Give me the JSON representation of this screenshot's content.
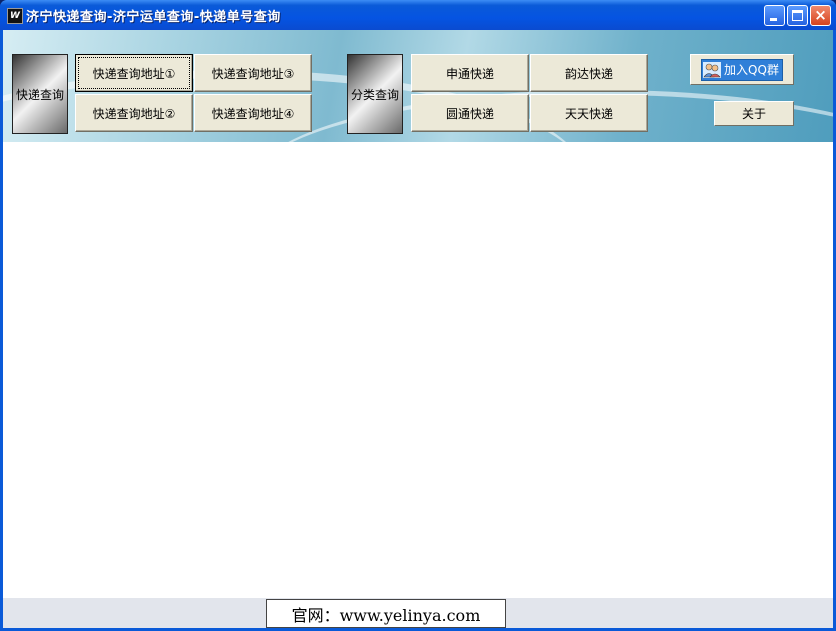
{
  "window": {
    "title": "济宁快递查询-济宁运单查询-快递单号查询",
    "app_icon_letter": "W",
    "controls": {
      "minimize": "minimize",
      "maximize": "maximize",
      "close": "×"
    }
  },
  "express_group": {
    "caption": "快递查询",
    "buttons": [
      "快递查询地址①",
      "快递查询地址③",
      "快递查询地址②",
      "快递查询地址④"
    ]
  },
  "category_group": {
    "caption": "分类查询",
    "buttons": [
      "申通快递",
      "韵达快递",
      "圆通快递",
      "天天快递"
    ]
  },
  "qq_button": {
    "label": "加入QQ群",
    "icon": "qq-group-icon"
  },
  "about_button": {
    "label": "关于"
  },
  "status": {
    "website": "官网：www.yelinya.com"
  },
  "colors": {
    "title_bar": "#0a5ad8",
    "button_face": "#ece9d8",
    "banner": "#7fbad0"
  }
}
